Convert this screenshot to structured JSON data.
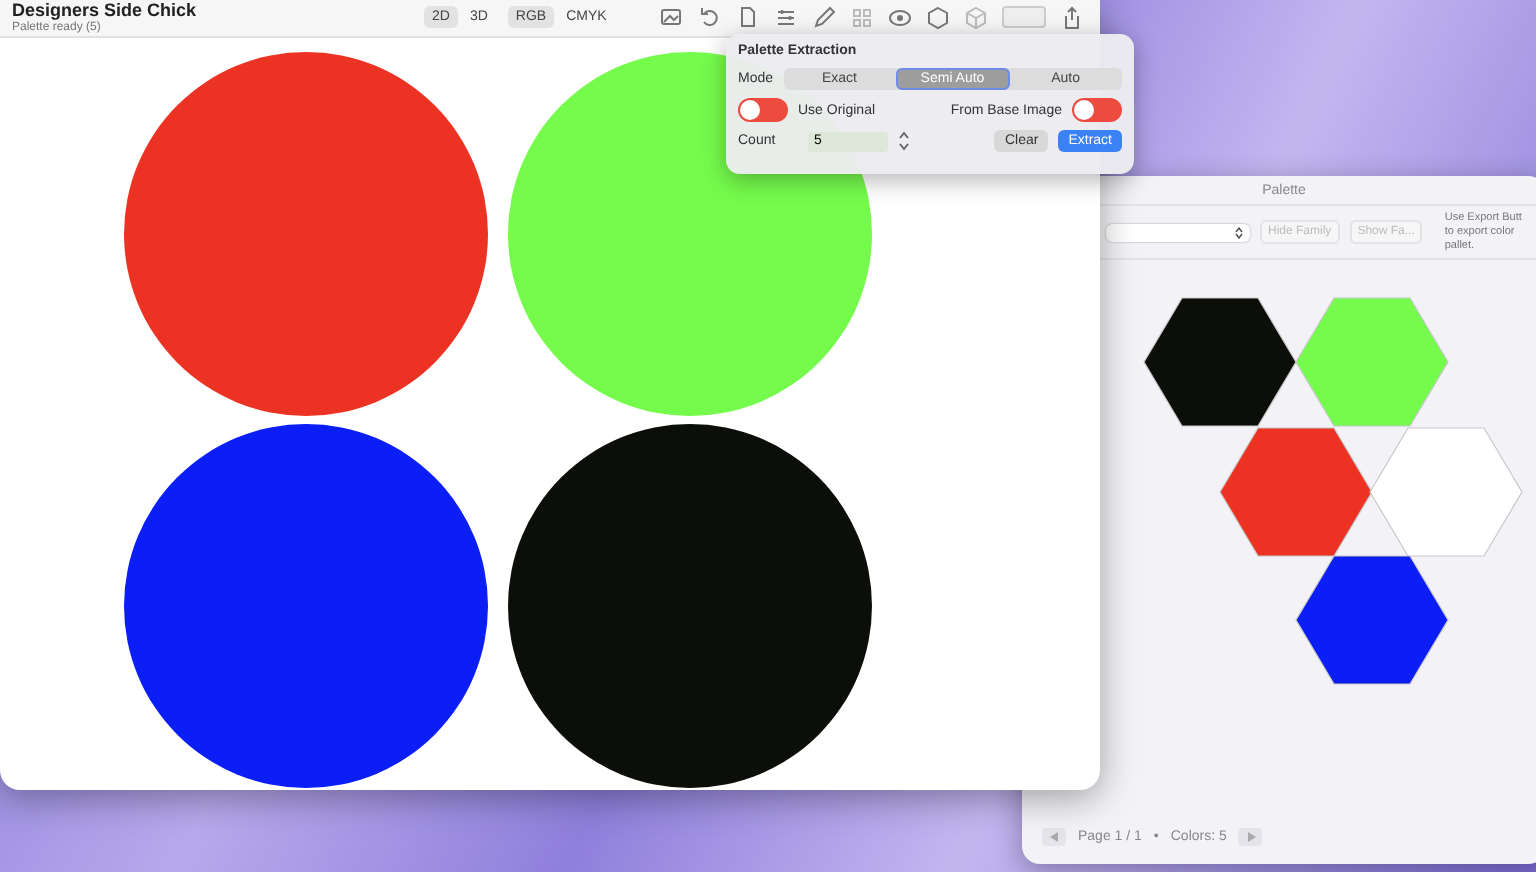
{
  "main_window": {
    "title": "Designers Side Chick",
    "subtitle": "Palette ready (5)",
    "view_modes": [
      {
        "label": "2D",
        "selected": true
      },
      {
        "label": "3D",
        "selected": false
      }
    ],
    "color_modes": [
      {
        "label": "RGB",
        "selected": true
      },
      {
        "label": "CMYK",
        "selected": false
      }
    ],
    "circles": [
      {
        "color": "#ec3323"
      },
      {
        "color": "#75fb4c"
      },
      {
        "color": "#0a1ef5"
      },
      {
        "color": "#0c0e0a"
      }
    ]
  },
  "popover": {
    "title": "Palette Extraction",
    "mode_label": "Mode",
    "modes": [
      {
        "label": "Exact",
        "selected": false
      },
      {
        "label": "Semi Auto",
        "selected": true
      },
      {
        "label": "Auto",
        "selected": false
      }
    ],
    "toggles": [
      {
        "label": "Use Original",
        "on": false
      },
      {
        "label": "From Base Image",
        "on": false
      }
    ],
    "count_label": "Count",
    "count_value": "5",
    "buttons": [
      {
        "label": "Clear",
        "kind": "plain"
      },
      {
        "label": "Extract",
        "kind": "primary"
      }
    ]
  },
  "palette_window": {
    "title": "Palette",
    "hide_button": "Hide Family",
    "show_button": "Show Fa...",
    "hint": "Use Export Butt\nto export color\npallet.",
    "hexagons": [
      {
        "color": "#0c0e0a"
      },
      {
        "color": "#75fb4c"
      },
      {
        "color": "#ec3323"
      },
      {
        "color": "#ffffff"
      },
      {
        "color": "#0a1ef5"
      }
    ],
    "page": "Page 1 / 1",
    "separator": "•",
    "colors_count": "Colors: 5"
  }
}
